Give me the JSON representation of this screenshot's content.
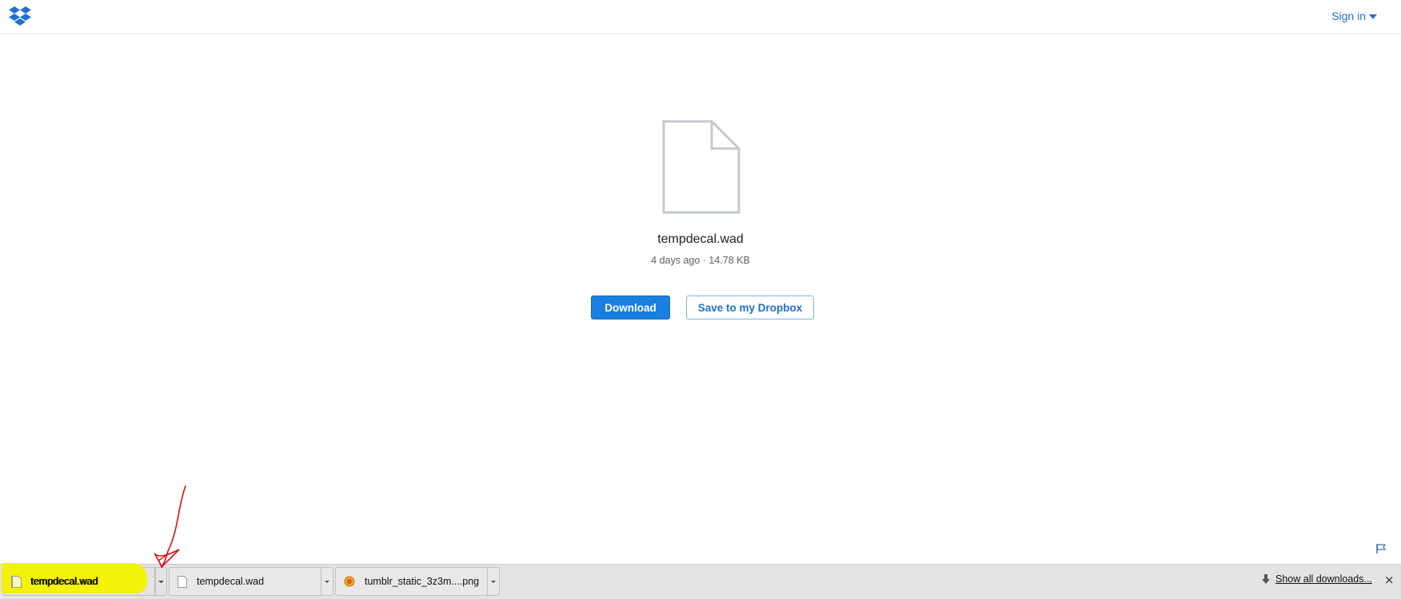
{
  "header": {
    "logo_icon": "dropbox-logo-icon",
    "signin_label": "Sign in",
    "accent": "#1f6fd0"
  },
  "file": {
    "icon": "file-icon",
    "name": "tempdecal.wad",
    "meta": "4 days ago · 14.78 KB"
  },
  "actions": {
    "download_label": "Download",
    "save_label": "Save to my Dropbox",
    "download_color": "#1b7fe0"
  },
  "footer": {
    "flag_icon": "flag-icon"
  },
  "downloads_bar": {
    "items": [
      {
        "label": "tempdecal.wad",
        "icon": "file-icon",
        "highlighted": true
      },
      {
        "label": "tempdecal.wad",
        "icon": "file-icon",
        "highlighted": false
      },
      {
        "label": "tumblr_static_3z3m....png",
        "icon": "image-file-icon",
        "highlighted": false
      }
    ],
    "show_all_label": "Show all downloads...",
    "show_all_icon": "download-arrow-icon",
    "close_icon": "close-icon",
    "close_glyph": "×",
    "highlight_color": "#f2f20a",
    "annotation_color": "#e01010"
  }
}
